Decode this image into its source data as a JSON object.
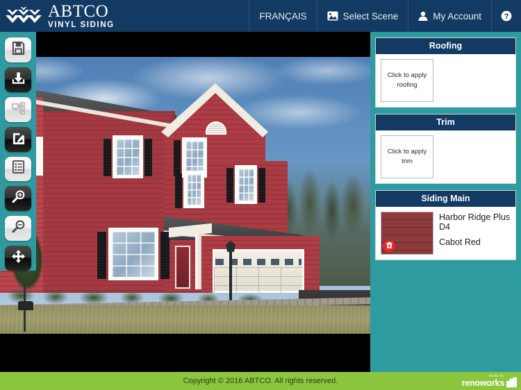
{
  "header": {
    "brand_title": "ABTCO",
    "brand_subtitle": "VINYL SIDING",
    "logo_icon": "chevron-cluster-logo-icon",
    "nav": [
      {
        "label": "FRANÇAIS",
        "icon": null,
        "name": "nav-francais"
      },
      {
        "label": "Select Scene",
        "icon": "image-icon",
        "name": "nav-select-scene"
      },
      {
        "label": "My Account",
        "icon": "user-icon",
        "name": "nav-my-account"
      },
      {
        "label": "",
        "icon": "help-circle-icon",
        "name": "nav-help"
      }
    ]
  },
  "toolbar": {
    "tools": [
      {
        "name": "save-button",
        "icon": "floppy-disk-icon",
        "style": "light"
      },
      {
        "name": "download-button",
        "icon": "download-tray-icon",
        "style": "dark"
      },
      {
        "name": "share-button",
        "icon": "network-share-icon",
        "style": "light-disabled"
      },
      {
        "name": "edit-button",
        "icon": "pencil-edit-icon",
        "style": "dark"
      },
      {
        "name": "list-button",
        "icon": "list-lines-icon",
        "style": "light"
      },
      {
        "name": "zoom-in-button",
        "icon": "magnifier-plus-icon",
        "style": "dark"
      },
      {
        "name": "zoom-out-button",
        "icon": "magnifier-minus-icon",
        "style": "light"
      },
      {
        "name": "pan-button",
        "icon": "move-arrows-icon",
        "style": "dark"
      }
    ]
  },
  "stage": {
    "scene_alt": "Two-story house with red vinyl siding, white trim, black shutters and attached two-car garage"
  },
  "panels": [
    {
      "name": "roofing-panel",
      "title": "Roofing",
      "placeholder": "Click to apply roofing",
      "applied": null
    },
    {
      "name": "trim-panel",
      "title": "Trim",
      "placeholder": "Click to apply trim",
      "applied": null
    },
    {
      "name": "siding-main-panel",
      "title": "Siding Main",
      "placeholder": null,
      "applied": {
        "product": "Harbor Ridge Plus D4",
        "color": "Cabot Red",
        "swatch_color": "#8c3a3c",
        "delete_icon": "trash-icon"
      }
    }
  ],
  "footer": {
    "copyright": "Copyright © 2016 ABTCO. All rights reserved.",
    "attribution_small": "made by",
    "attribution_brand": "renoworks",
    "attribution_icon": "building-blocks-icon"
  },
  "colors": {
    "header_navy": "#123a63",
    "teal": "#2e9ba1",
    "footer_green": "#8cc63e",
    "delete_red": "#e02b2b",
    "siding_red": "#8c3a3c"
  }
}
